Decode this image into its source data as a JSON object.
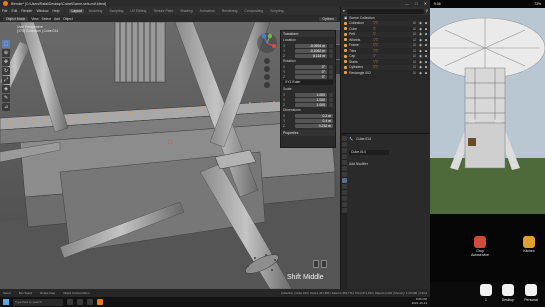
{
  "window": {
    "title": "Blender* [C:\\Users\\Rafal\\Desktop\\Crane\\Scene-sets-mdl.blend]",
    "controls": [
      "—",
      "□",
      "✕"
    ]
  },
  "menubar": {
    "items": [
      "File",
      "Edit",
      "Render",
      "Window",
      "Help"
    ],
    "workspaces": [
      "Layout",
      "Modeling",
      "Sculpting",
      "UV Editing",
      "Texture Paint",
      "Shading",
      "Animation",
      "Rendering",
      "Compositing",
      "Scripting"
    ],
    "active_workspace": "Layout",
    "scene": "Scene",
    "view_layer": "View Layer"
  },
  "viewport_header": {
    "mode": "Object Mode",
    "menus": [
      "View",
      "Select",
      "Add",
      "Object"
    ],
    "options": "Options"
  },
  "viewport_info": {
    "line1": "User Perspective",
    "line2": "(175) Collection | Cube.014"
  },
  "toolbar": {
    "tools": [
      "select-icon",
      "cursor-icon",
      "move-icon",
      "rotate-icon",
      "scale-icon",
      "transform-icon",
      "annotate-icon",
      "measure-icon"
    ]
  },
  "npanel": {
    "header": "Transform",
    "location_label": "Location",
    "location": [
      {
        "axis": "X",
        "value": "-0.0594 m"
      },
      {
        "axis": "Y",
        "value": "-0.1062 m"
      },
      {
        "axis": "Z",
        "value": "6.114 m"
      }
    ],
    "rotation_label": "Rotation",
    "rotation": [
      {
        "axis": "X",
        "value": "0°"
      },
      {
        "axis": "Y",
        "value": "0°"
      },
      {
        "axis": "Z",
        "value": "0°"
      }
    ],
    "rotation_mode": "XYZ Euler",
    "scale_label": "Scale",
    "scale": [
      {
        "axis": "X",
        "value": "1.000"
      },
      {
        "axis": "Y",
        "value": "1.000"
      },
      {
        "axis": "Z",
        "value": "1.000"
      }
    ],
    "dimensions_label": "Dimensions",
    "dimensions": [
      {
        "axis": "X",
        "value": "0.2 m"
      },
      {
        "axis": "Y",
        "value": "0.4 m"
      },
      {
        "axis": "Z",
        "value": "0.232 m"
      }
    ],
    "properties_label": "Properties"
  },
  "overlay": {
    "shift_text": "Shift Middle"
  },
  "outliner": {
    "title": "Scene Collection",
    "rows": [
      {
        "name": "Collection",
        "mods": "▽▽"
      },
      {
        "name": "Cube",
        "mods": "▽"
      },
      {
        "name": "Pelt",
        "mods": "▽"
      },
      {
        "name": "Wheels",
        "mods": "▽▽"
      },
      {
        "name": "Frame",
        "mods": "▽▽"
      },
      {
        "name": "Tiles",
        "mods": "▽▽"
      },
      {
        "name": "Cap",
        "mods": "▽"
      },
      {
        "name": "Stairs",
        "mods": "▽▽"
      },
      {
        "name": "Cylinders",
        "mods": "▽▽"
      },
      {
        "name": "Rectangle.002",
        "mods": ""
      }
    ]
  },
  "properties": {
    "object_name": "Cube.014",
    "field": "Cube.014",
    "section": "Add Modifier"
  },
  "statusbar": {
    "left1": "Select",
    "left2": "Box Select",
    "left3": "Rotate View",
    "left4": "Object Context Menu",
    "stats": "Collection | Cube.014 | Verts:1,447,954 | Faces:1,354,716 | Tris:2,571,454 | Objects:1/102 | Memory: 1.29 GiB | 2.93.4"
  },
  "taskbar": {
    "search": "Type here to search",
    "time": "9:06 PM",
    "date": "2021-10-14"
  },
  "phone": {
    "time": "9:06",
    "battery": "73%",
    "apps": [
      {
        "label": "Grup",
        "sub": "Autoservice"
      },
      {
        "label": "Kitchen"
      }
    ],
    "dock_labels": [
      "1",
      "Desktop",
      "Personal"
    ]
  },
  "colors": {
    "accent": "#e87d0d",
    "selection": "#5a7fb8",
    "panel": "#2b2b2b",
    "viewport_bg": "#595959"
  }
}
